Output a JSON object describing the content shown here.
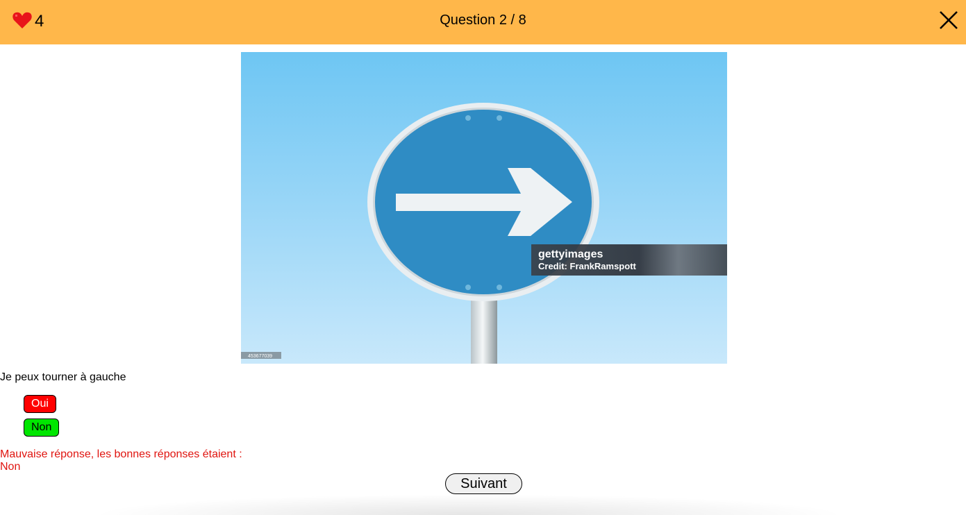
{
  "header": {
    "lives_count": "4",
    "question_counter": "Question 2 / 8",
    "heart_icon": "heart-icon",
    "close_icon": "close-icon",
    "background_color": "#ffb74a"
  },
  "image": {
    "watermark_brand": "gettyimages",
    "watermark_credit": "Credit: FrankRamspott",
    "stock_id": "453677039"
  },
  "question": {
    "text": "Je peux tourner à gauche"
  },
  "answers": [
    {
      "label": "Oui",
      "state": "wrong-selected",
      "color": "#ff0000"
    },
    {
      "label": "Non",
      "state": "correct",
      "color": "#00e600"
    }
  ],
  "feedback": {
    "message": "Mauvaise réponse, les bonnes réponses étaient :",
    "correct_answer": "Non",
    "color": "#e0140f"
  },
  "navigation": {
    "next_label": "Suivant"
  }
}
